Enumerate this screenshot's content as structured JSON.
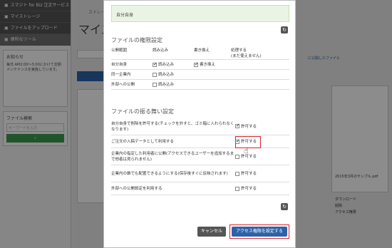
{
  "sidebar": {
    "items": [
      {
        "label": "スマジト for Biz 注文サービス"
      },
      {
        "label": "マイストレージ"
      },
      {
        "label": "ファイルをアップロード"
      },
      {
        "label": "便利なツール"
      }
    ],
    "news_title": "お知らせ",
    "news_text": "毎日 AM2:00～3:00にかけて定期メンテナンスを実施しています。",
    "search_title": "ファイル検索",
    "search_placeholder": "キーワードを入力"
  },
  "background": {
    "crumb": "ストレージサー",
    "title": "マイス",
    "right_text": "に公開したファイル",
    "card_label": "2015年3月のサンプル.pdf",
    "download": "ダウンロード",
    "delete": "削除",
    "access": "アクセス権限"
  },
  "modal": {
    "note": "自分自身",
    "section1_title": "ファイルの権限設定",
    "perm_headers": {
      "scope": "公開範囲",
      "read": "読み込み",
      "write": "書き換え",
      "delete": "処理する\n(まだ使えません)"
    },
    "perm_rows": [
      {
        "scope": "自分自身",
        "read": "読み込み",
        "read_on": true,
        "write": "書き換え",
        "write_on": true
      },
      {
        "scope": "同一企業内",
        "read": "読み込み",
        "read_on": false,
        "write": "",
        "write_on": false
      },
      {
        "scope": "外部への公開",
        "read": "読み込み",
        "read_on": false,
        "write": "",
        "write_on": false
      }
    ],
    "section2_title": "ファイルの振る舞い設定",
    "behaviors": [
      {
        "label": "自分自身で削除を許可する(チェックを外すと、ゴミ箱に入れられなくなります)",
        "allow": "許可する",
        "on": true
      },
      {
        "label": "ご注文の入稿データとして利用する",
        "allow": "許可する",
        "on": true
      },
      {
        "label": "企業内の指定した利用者に公開(アクセスできるユーザーを追加するまで他者は見られません)",
        "allow": "許可する",
        "on": false
      },
      {
        "label": "企業内の誰でも配置できるようにする(保存後すぐに反映されます)",
        "allow": "許可する",
        "on": false
      },
      {
        "label": "外部への公開設定を利用する",
        "allow": "許可する",
        "on": false
      }
    ],
    "cancel": "キャンセル",
    "submit": "アクセス権限を設定する"
  }
}
